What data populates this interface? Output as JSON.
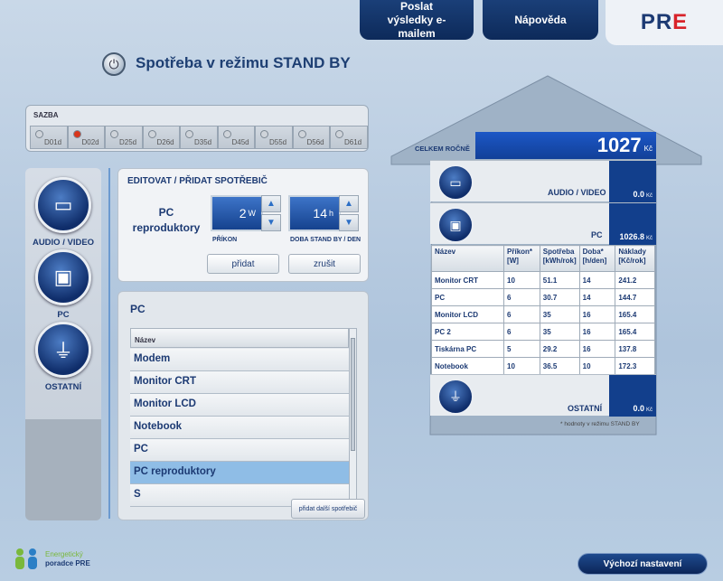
{
  "header": {
    "email_btn": "Poslat výsledky e-mailem",
    "help_btn": "Nápověda",
    "logo_pr": "PR",
    "logo_e": "E"
  },
  "page_title": "Spotřeba v režimu STAND BY",
  "sazba": {
    "label": "SAZBA",
    "rates": [
      "D01d",
      "D02d",
      "D25d",
      "D26d",
      "D35d",
      "D45d",
      "D55d",
      "D56d",
      "D61d"
    ],
    "selected": "D02d"
  },
  "categories": [
    {
      "label": "AUDIO / VIDEO",
      "icon": "audio-video-icon"
    },
    {
      "label": "PC",
      "icon": "pc-icon"
    },
    {
      "label": "OSTATNÍ",
      "icon": "plug-icon"
    }
  ],
  "edit": {
    "title": "EDITOVAT / PŘIDAT SPOTŘEBIČ",
    "device_line1": "PC",
    "device_line2": "reproduktory",
    "power_value": "2",
    "power_unit": "W",
    "power_label": "PŘÍKON",
    "standby_value": "14",
    "standby_unit": "h",
    "standby_label": "DOBA STAND BY / DEN",
    "add_btn": "přidat",
    "cancel_btn": "zrušit"
  },
  "list": {
    "title": "PC",
    "header": "Název",
    "items": [
      "Modem",
      "Monitor CRT",
      "Monitor LCD",
      "Notebook",
      "PC",
      "PC reproduktory",
      "S"
    ],
    "selected_index": 5,
    "more_btn": "přidat další spotřebič"
  },
  "house": {
    "total_label": "CELKEM ROČNĚ",
    "total_value": "1027",
    "total_unit": "Kč",
    "audio_label": "AUDIO / VIDEO",
    "audio_value": "0.0",
    "pc_label": "PC",
    "pc_value": "1026.8",
    "other_label": "OSTATNÍ",
    "other_value": "0.0",
    "unit": "Kč",
    "table_headers": [
      "Název",
      "Příkon* [W]",
      "Spotřeba [kWh/rok]",
      "Doba* [h/den]",
      "Náklady [Kč/rok]"
    ],
    "table_rows": [
      [
        "Monitor CRT",
        "10",
        "51.1",
        "14",
        "241.2"
      ],
      [
        "PC",
        "6",
        "30.7",
        "14",
        "144.7"
      ],
      [
        "Monitor LCD",
        "6",
        "35",
        "16",
        "165.4"
      ],
      [
        "PC 2",
        "6",
        "35",
        "16",
        "165.4"
      ],
      [
        "Tiskárna PC",
        "5",
        "29.2",
        "16",
        "137.8"
      ],
      [
        "Notebook",
        "10",
        "36.5",
        "10",
        "172.3"
      ]
    ],
    "note": "* hodnoty v režimu STAND BY"
  },
  "footer": {
    "logo_line1": "Energetický",
    "logo_line2": "poradce PRE",
    "reset_btn": "Výchozí nastavení"
  }
}
